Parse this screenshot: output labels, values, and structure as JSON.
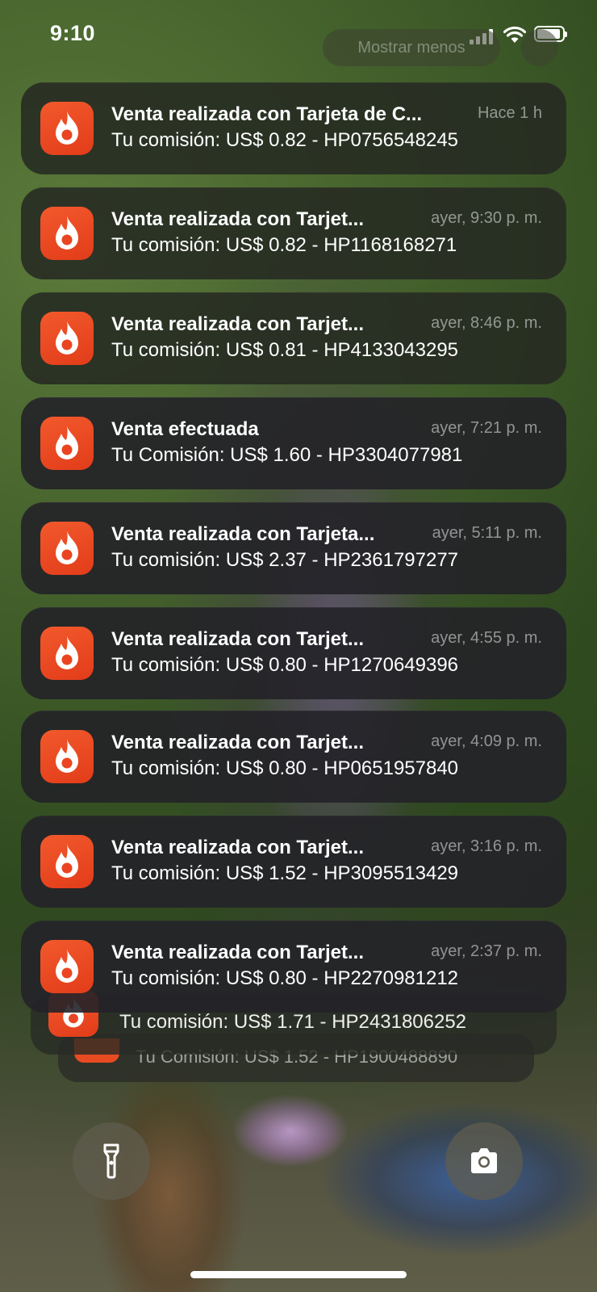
{
  "status": {
    "time": "9:10"
  },
  "ghost": {
    "pill_label": "Mostrar menos"
  },
  "notifications": [
    {
      "app_icon": "flame-icon",
      "title": "Venta realizada con Tarjeta de C...",
      "time": "Hace 1 h",
      "body": "Tu comisión: US$ 0.82 - HP0756548245"
    },
    {
      "app_icon": "flame-icon",
      "title": "Venta realizada con Tarjet...",
      "time": "ayer, 9:30 p. m.",
      "body": "Tu comisión: US$ 0.82 - HP1168168271"
    },
    {
      "app_icon": "flame-icon",
      "title": "Venta realizada con Tarjet...",
      "time": "ayer, 8:46 p. m.",
      "body": "Tu comisión: US$ 0.81 - HP4133043295"
    },
    {
      "app_icon": "flame-icon",
      "title": "Venta efectuada",
      "time": "ayer, 7:21 p. m.",
      "body": "Tu Comisión: US$ 1.60 - HP3304077981"
    },
    {
      "app_icon": "flame-icon",
      "title": "Venta realizada con Tarjeta...",
      "time": "ayer, 5:11 p. m.",
      "body": "Tu comisión: US$ 2.37 - HP2361797277"
    },
    {
      "app_icon": "flame-icon",
      "title": "Venta realizada con Tarjet...",
      "time": "ayer, 4:55 p. m.",
      "body": "Tu comisión: US$ 0.80 - HP1270649396"
    },
    {
      "app_icon": "flame-icon",
      "title": "Venta realizada con Tarjet...",
      "time": "ayer, 4:09 p. m.",
      "body": "Tu comisión: US$ 0.80 - HP0651957840"
    },
    {
      "app_icon": "flame-icon",
      "title": "Venta realizada con Tarjet...",
      "time": "ayer, 3:16 p. m.",
      "body": "Tu comisión: US$ 1.52 - HP3095513429"
    },
    {
      "app_icon": "flame-icon",
      "title": "Venta realizada con Tarjet...",
      "time": "ayer, 2:37 p. m.",
      "body": "Tu comisión: US$ 0.80 - HP2270981212"
    }
  ],
  "stacked": [
    {
      "body": "Tu comisión: US$ 1.71 - HP2431806252"
    },
    {
      "body": "Tu Comisión: US$ 1.52 - HP1900488890"
    }
  ],
  "buttons": {
    "left_icon": "flashlight-icon",
    "right_icon": "camera-icon"
  },
  "colors": {
    "app_icon": "#ee4a22",
    "card": "#262a22"
  }
}
